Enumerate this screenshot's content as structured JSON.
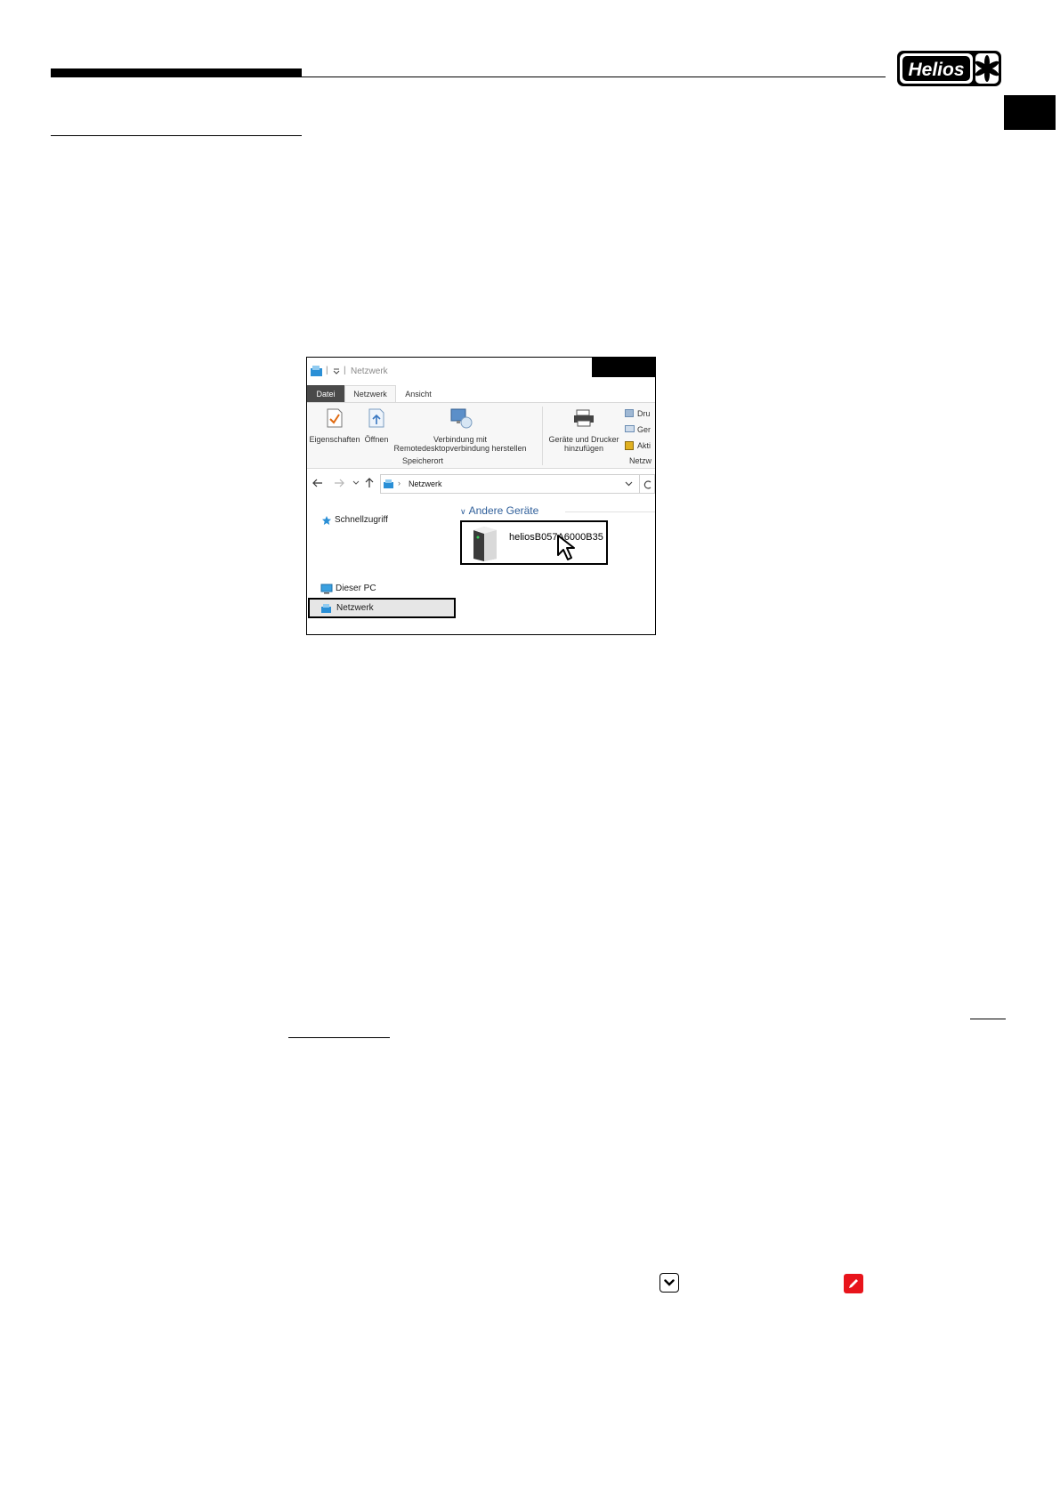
{
  "header": {
    "logo_text": "Helios"
  },
  "explorer": {
    "window_title": "Netzwerk",
    "tabs": [
      "Datei",
      "Netzwerk",
      "Ansicht"
    ],
    "ribbon": {
      "properties_label": "Eigenschaften",
      "open_label": "Öffnen",
      "remote_label_1": "Verbindung mit",
      "remote_label_2": "Remotedesktopverbindung herstellen",
      "group_location": "Speicherort",
      "devices_label_1": "Geräte und Drucker",
      "devices_label_2": "hinzufügen",
      "side_items": [
        "Dru",
        "Ger",
        "Akti"
      ],
      "group_network": "Netzw"
    },
    "address": {
      "path": "Netzwerk"
    },
    "nav": {
      "quick_access": "Schnellzugriff",
      "this_pc": "Dieser PC",
      "network": "Netzwerk"
    },
    "content": {
      "group_header": "Andere Geräte",
      "device_name": "heliosB057A6000B35"
    }
  },
  "colors": {
    "accent_blue": "#2f5f9a",
    "edit_red": "#e8141b",
    "dark_tab": "#4a4a4a"
  },
  "icons": {
    "chevron_button": "chevron-down-icon",
    "edit_button": "pencil-icon"
  }
}
